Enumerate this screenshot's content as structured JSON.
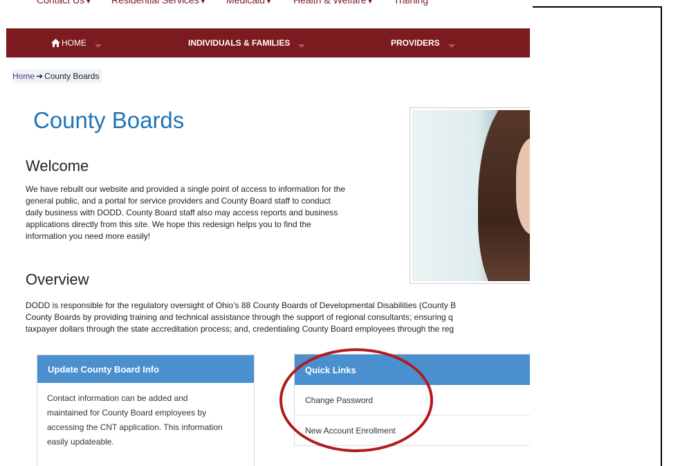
{
  "top_nav": {
    "items": [
      {
        "label": "Contact Us"
      },
      {
        "label": "Residential Services"
      },
      {
        "label": "Medicaid"
      },
      {
        "label": "Health & Welfare"
      },
      {
        "label": "Training"
      }
    ]
  },
  "main_nav": {
    "items": [
      {
        "label": "HOME"
      },
      {
        "label": "INDIVIDUALS & FAMILIES"
      },
      {
        "label": "PROVIDERS"
      }
    ]
  },
  "breadcrumb": {
    "home": "Home",
    "current": "County Boards"
  },
  "page": {
    "title": "County Boards",
    "welcome_heading": "Welcome",
    "welcome_lines": [
      "We have rebuilt our website and provided a single point of access to information for the",
      "general public, and a portal for service providers and County Board staff to conduct",
      "daily business with DODD. County Board staff also may access reports and business",
      "applications directly from this site. We hope this redesign helps you to find the",
      "information you need more easily!"
    ],
    "overview_heading": "Overview",
    "overview_lines": [
      "DODD is responsible for the regulatory oversight of Ohio’s 88 County Boards of Developmental Disabilities (County B",
      "County Boards by providing training and technical assistance through the support of regional consultants; ensuring q",
      "taxpayer dollars through the state accreditation process; and, credentialing County Board employees through the reg"
    ]
  },
  "update_panel": {
    "title": "Update County Board Info",
    "body_lines": [
      "Contact information can be added and",
      "maintained for County Board employees by",
      "accessing the CNT application.  This information",
      "easily updateable."
    ]
  },
  "quick_links": {
    "title": "Quick Links",
    "items": [
      {
        "label": "Change Password"
      },
      {
        "label": "New Account Enrollment"
      }
    ]
  },
  "colors": {
    "nav_bg": "#7b1a1f",
    "title_blue": "#1f74b6",
    "panel_head": "#4a8fce",
    "annotation_red": "#b11a1e"
  }
}
